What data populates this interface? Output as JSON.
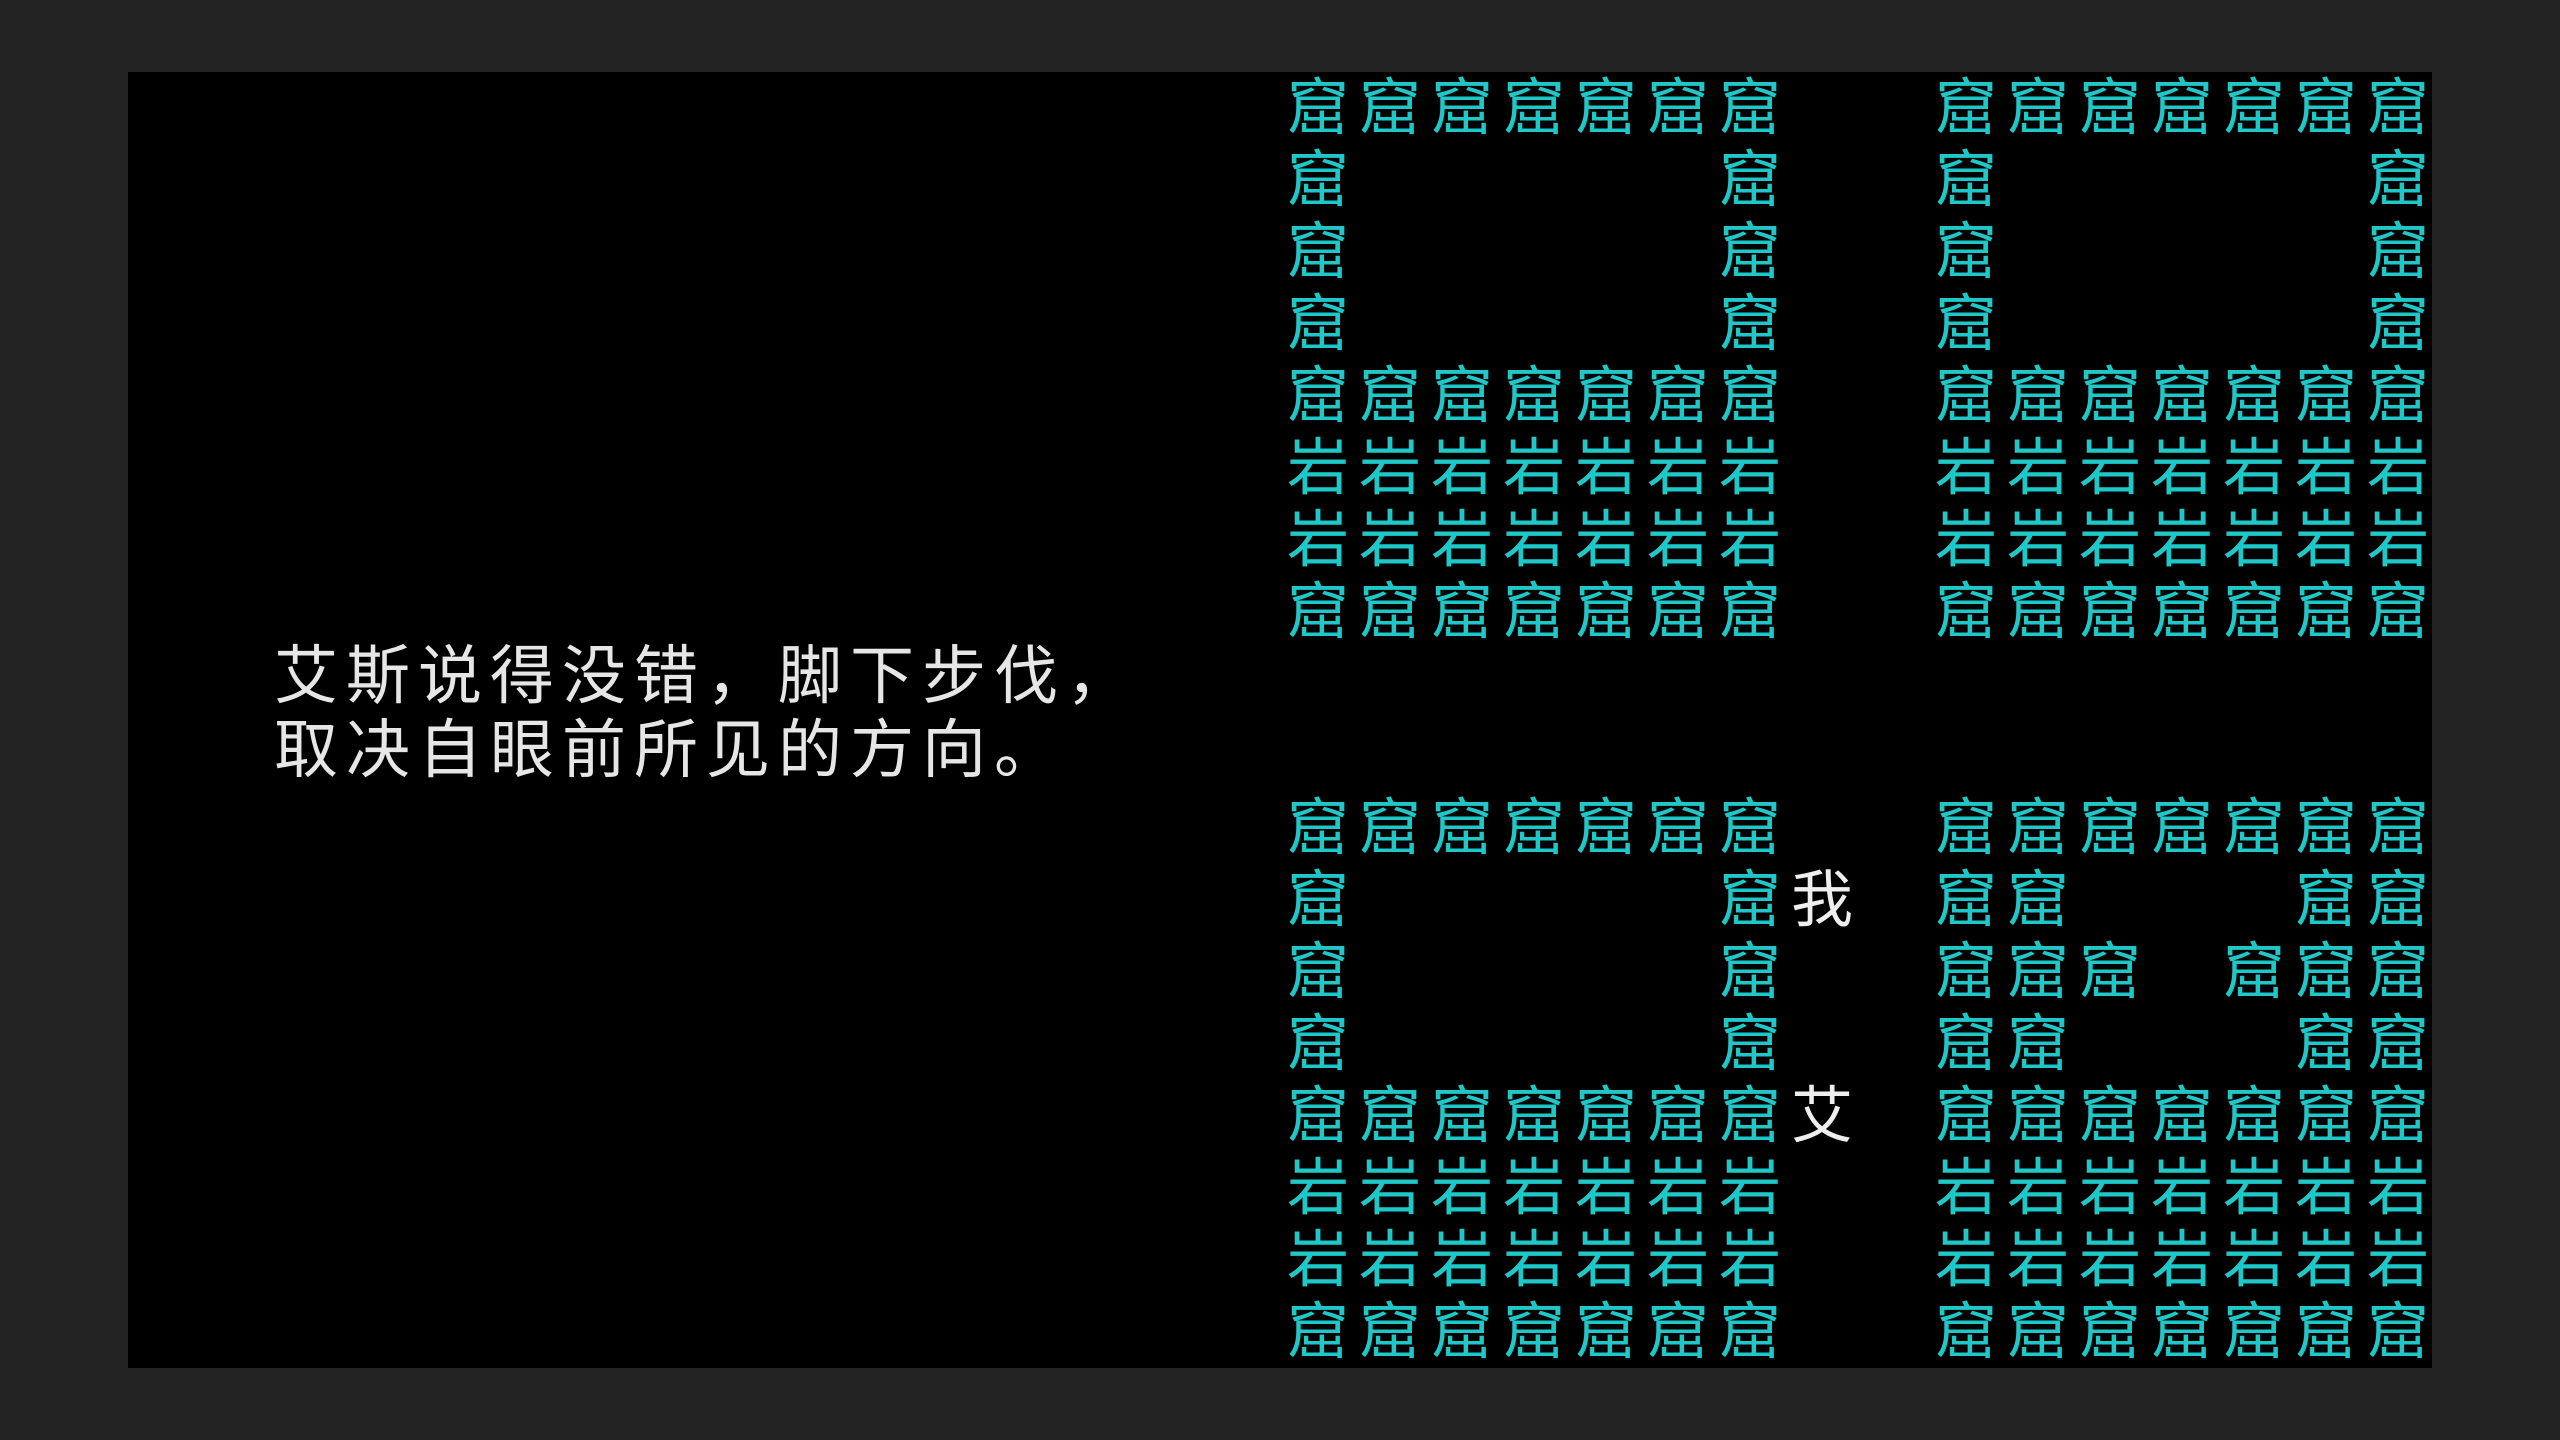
{
  "narration": {
    "line1": "艾斯说得没错，脚下步伐，",
    "line2": "取决自眼前所见的方向。"
  },
  "glyphs": {
    "wall": "窟",
    "rock": "岩",
    "player": "我",
    "companion": "艾"
  },
  "colors": {
    "background": "#000000",
    "frame": "#232323",
    "tiles": "#1ec8c8",
    "text": "#e6e6e6"
  },
  "map": {
    "legend": {
      "W": "wall",
      "R": "rock",
      "P": "player",
      "A": "companion",
      ".": "empty"
    },
    "rows": [
      "WWWWWWW..WWWWWWW",
      "W.....W..W.....W",
      "W.....W..W.....W",
      "W.....W..W.....W",
      "WWWWWWW..WWWWWWW",
      "RRRRRRR..RRRRRRR",
      "RRRRRRR..RRRRRRR",
      "WWWWWWW..WWWWWWW",
      "................",
      "................",
      "WWWWWWW..WWWWWWW",
      "W.....WP.WW...WW",
      "W.....W..WWW.WWW",
      "W.....W..WW...WW",
      "WWWWWWWA.WWWWWWW",
      "RRRRRRR..RRRRRRR",
      "RRRRRRR..RRRRRRR",
      "WWWWWWW..WWWWWWW"
    ]
  }
}
